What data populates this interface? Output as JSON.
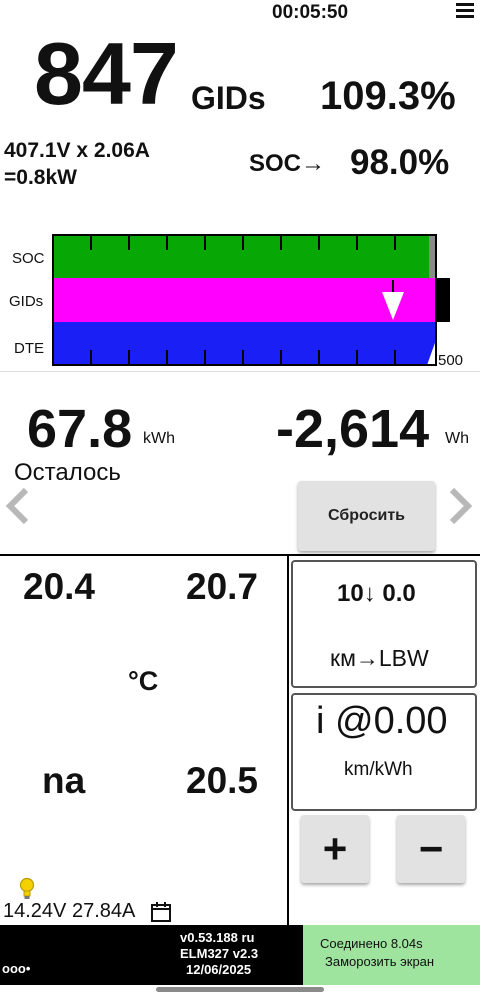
{
  "status": {
    "clock": "00:05:50"
  },
  "battery": {
    "gids": "847",
    "gids_unit": "GIDs",
    "gids_percent": "109.3%",
    "power_line1": "407.1V x 2.06A",
    "power_line2": "=0.8kW",
    "soc_label": "SOC→",
    "soc_value": "98.0%"
  },
  "bars": {
    "labels": {
      "soc": "SOC",
      "gids": "GIDs",
      "dte": "DTE"
    },
    "scale_max": "500",
    "soc_fraction": 0.98,
    "gids_fraction": 1.0,
    "dte_fraction": 1.0,
    "colors": {
      "soc": "#07a806",
      "gids": "#ff00ff",
      "dte": "#1a20f5"
    }
  },
  "energy": {
    "remaining_value": "67.8",
    "remaining_unit": "kWh",
    "delta_value": "-2,614",
    "delta_unit": "Wh",
    "remaining_label": "Осталось",
    "reset_label": "Сбросить"
  },
  "temperatures": {
    "t1": "20.4",
    "t2": "20.7",
    "unit": "°C",
    "t3": "na",
    "t4": "20.5"
  },
  "aux_battery": {
    "readout": "14.24V 27.84A"
  },
  "range": {
    "value": "10↓ 0.0",
    "label": "км→LBW",
    "efficiency_value": "i @0.00",
    "efficiency_unit": "km/kWh",
    "plus_label": "+",
    "minus_label": "−"
  },
  "footer": {
    "version": "v0.53.188 ru",
    "adapter": "ELM327 v2.3",
    "date": "12/06/2025",
    "connection": "Соединено 8.04s",
    "freeze": "Заморозить экран",
    "dots": "ooo•"
  },
  "icons": [
    "menu-icon",
    "chevron-left-icon",
    "chevron-right-icon",
    "lightbulb-icon",
    "calendar-icon"
  ]
}
